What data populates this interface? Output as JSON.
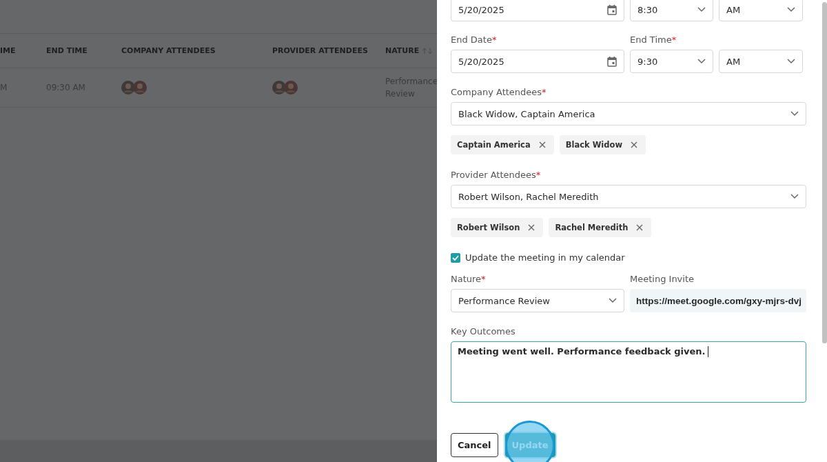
{
  "table": {
    "columns": [
      {
        "label": "IME",
        "sortable": false
      },
      {
        "label": "END TIME",
        "sortable": false
      },
      {
        "label": "COMPANY ATTENDEES",
        "sortable": false
      },
      {
        "label": "PROVIDER ATTENDEES",
        "sortable": false
      },
      {
        "label": "NATURE",
        "sortable": true
      }
    ],
    "rows": [
      {
        "time": "M",
        "end_time": "09:30 AM",
        "nature": "Performance Review"
      }
    ]
  },
  "form": {
    "required_mark": "*",
    "start": {
      "date": "5/20/2025",
      "time": "8:30",
      "period": "AM"
    },
    "end": {
      "date_label": "End Date",
      "date_required": true,
      "time_label": "End Time",
      "time_required": true,
      "date": "5/20/2025",
      "time": "9:30",
      "period": "AM"
    },
    "company_attendees": {
      "label": "Company Attendees",
      "required": true,
      "value": "Black Widow, Captain America",
      "chips": [
        "Captain America",
        "Black Widow"
      ]
    },
    "provider_attendees": {
      "label": "Provider Attendees",
      "required": true,
      "value": "Robert Wilson, Rachel Meredith",
      "chips": [
        "Robert Wilson",
        "Rachel Meredith"
      ]
    },
    "calendar_update": {
      "label": "Update the meeting in my calendar",
      "checked": true
    },
    "nature": {
      "label": "Nature",
      "required": true,
      "value": "Performance Review"
    },
    "meeting_invite": {
      "label": "Meeting Invite",
      "value": "https://meet.google.com/gxy-mjrs-dvj"
    },
    "key_outcomes": {
      "label": "Key Outcomes",
      "value": "Meeting went well. Performance feedback given."
    },
    "buttons": [
      {
        "label": "Cancel",
        "kind": "secondary",
        "highlighted": false
      },
      {
        "label": "Update",
        "kind": "primary",
        "highlighted": true
      }
    ]
  }
}
